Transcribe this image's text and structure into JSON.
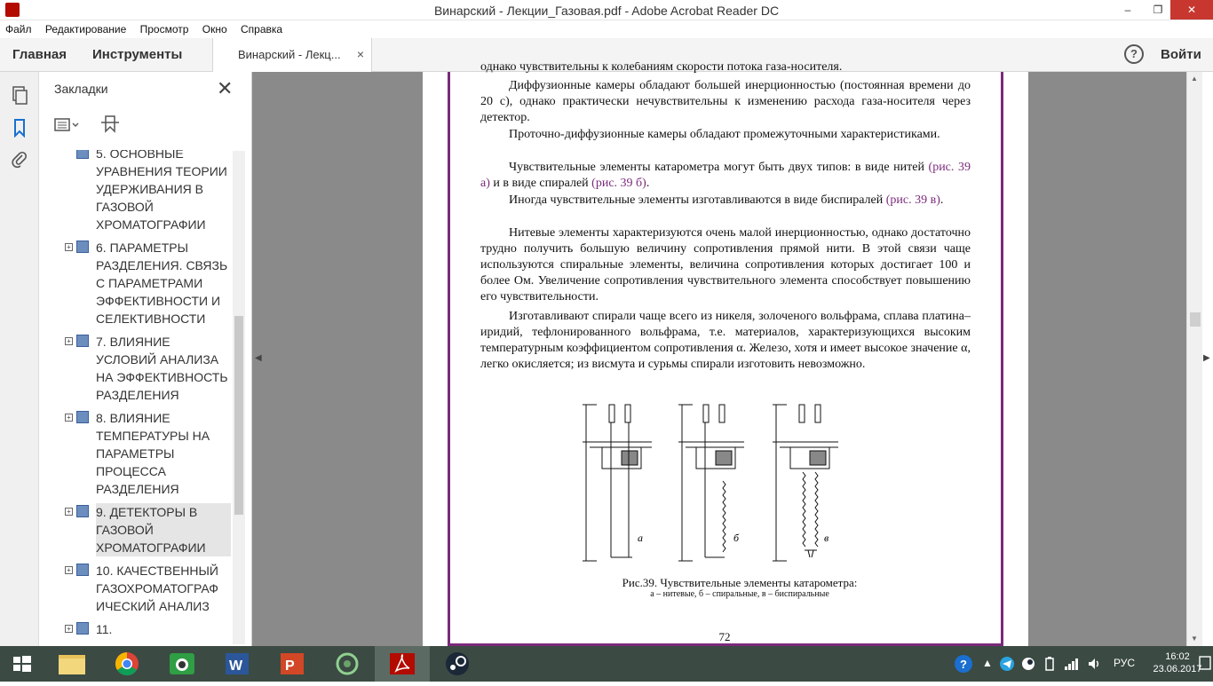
{
  "window": {
    "title": "Винарский - Лекции_Газовая.pdf - Adobe Acrobat Reader DC",
    "minimize": "–",
    "restore": "❐",
    "close": "✕"
  },
  "menu": [
    "Файл",
    "Редактирование",
    "Просмотр",
    "Окно",
    "Справка"
  ],
  "toolbar": {
    "home": "Главная",
    "tools": "Инструменты",
    "doc_tab": "Винарский - Лекц...",
    "doc_tab_close": "×",
    "help": "?",
    "sign_in": "Войти"
  },
  "bookmarks_panel": {
    "title": "Закладки",
    "close": "✕",
    "items": [
      {
        "text": "5. ОСНОВНЫЕ\nУРАВНЕНИЯ ТЕОРИИ\n УДЕРЖИВАНИЯ В\nГАЗОВОЙ\nХРОМАТОГРАФИИ",
        "expand": "+",
        "selected": false
      },
      {
        "text": "6. ПАРАМЕТРЫ\nРАЗДЕЛЕНИЯ. СВЯЗЬ\nС ПАРАМЕТРАМИ\nЭФФЕКТИВНОСТИ И\nСЕЛЕКТИВНОСТИ",
        "expand": "+",
        "selected": false
      },
      {
        "text": "7. ВЛИЯНИЕ\nУСЛОВИЙ АНАЛИЗА\nНА ЭФФЕКТИВНОСТЬ\nРАЗДЕЛЕНИЯ",
        "expand": "+",
        "selected": false
      },
      {
        "text": "8. ВЛИЯНИЕ\nТЕМПЕРАТУРЫ НА\nПАРАМЕТРЫ\nПРОЦЕССА\nРАЗДЕЛЕНИЯ",
        "expand": "+",
        "selected": false
      },
      {
        "text": "9. ДЕТЕКТОРЫ  В\nГАЗОВОЙ\nХРОМАТОГРАФИИ",
        "expand": "+",
        "selected": true
      },
      {
        "text": "10. КАЧЕСТВЕННЫЙ\nГАЗОХРОМАТОГРАФ\nИЧЕСКИЙ  АНАЛИЗ",
        "expand": "+",
        "selected": false
      },
      {
        "text": "11.",
        "expand": "+",
        "selected": false
      }
    ]
  },
  "document": {
    "top_line": "однако чувствительны к колебаниям скорости потока газа-носителя.",
    "paragraphs": [
      {
        "parts": [
          {
            "t": "Диффузионные камеры обладают большей инерционностью (постоянная времени до 20 с), однако практически нечувствительны к изменению расхода газа-носителя через детектор."
          }
        ]
      },
      {
        "parts": [
          {
            "t": "Проточно-диффузионные камеры обладают промежуточными характеристиками."
          }
        ]
      },
      {
        "parts": [
          {
            "t": "Чувствительные элементы катарометра могут быть двух типов: в виде нитей "
          },
          {
            "t": "(рис. 39 а)",
            "ref": true
          },
          {
            "t": " и в виде спиралей "
          },
          {
            "t": "(рис. 39 б)",
            "ref": true
          },
          {
            "t": "."
          }
        ]
      },
      {
        "parts": [
          {
            "t": "Иногда чувствительные элементы изготавливаются в виде биспиралей "
          },
          {
            "t": "(рис. 39 в)",
            "ref": true
          },
          {
            "t": "."
          }
        ]
      },
      {
        "parts": [
          {
            "t": "Нитевые элементы характеризуются очень малой инерционностью, однако достаточно трудно получить большую величину сопротивления прямой нити. В этой связи чаще используются спиральные элементы, величина сопротивления которых достигает 100 и более Ом. Увеличение сопротивления чувствительного элемента способствует повышению его чувствительности."
          }
        ]
      },
      {
        "parts": [
          {
            "t": "Изготавливают спирали чаще всего из никеля, золоченого вольфрама, сплава платина–иридий, тефлонированного вольфрама, т.е. материалов, характеризующихся высоким температурным коэффициентом сопротивления α. Железо, хотя и имеет высокое значение α, легко окисляется; из висмута и сурьмы спирали изготовить невозможно."
          }
        ]
      }
    ],
    "figure_labels": [
      "а",
      "б",
      "в"
    ],
    "caption": "Рис.39. Чувствительные элементы катарометра:",
    "subcaption": "а – нитевые, б – спиральные, в – биспиральные",
    "page_number": "72"
  },
  "taskbar": {
    "apps": [
      "start",
      "file-explorer",
      "chrome",
      "camera",
      "word",
      "powerpoint",
      "tool",
      "acrobat",
      "steam"
    ],
    "language": "РУС",
    "time": "16:02",
    "date": "23.06.2017"
  }
}
